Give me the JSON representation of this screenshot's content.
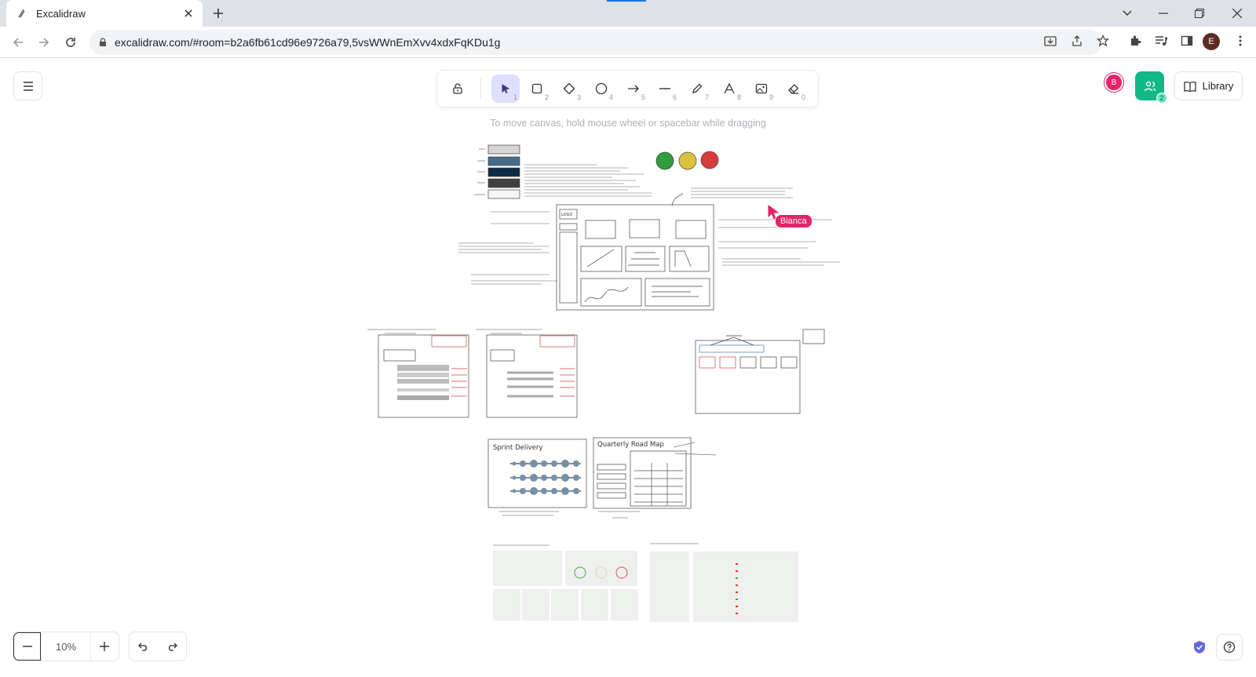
{
  "browser": {
    "tab_title": "Excalidraw",
    "url": "excalidraw.com/#room=b2a6fb61cd96e9726a79,5vsWWnEmXvv4xdxFqKDu1g",
    "profile_initial": "E"
  },
  "app": {
    "hint": "To move canvas, hold mouse wheel or spacebar while dragging",
    "library_label": "Library",
    "zoom": "10%",
    "collaborator_avatar": "B",
    "collaborator_count": "2",
    "collaborator_name": "Bianca",
    "tools": [
      {
        "name": "lock-icon",
        "key": ""
      },
      {
        "name": "selection-icon",
        "key": "1"
      },
      {
        "name": "rectangle-icon",
        "key": "2"
      },
      {
        "name": "diamond-icon",
        "key": "3"
      },
      {
        "name": "ellipse-icon",
        "key": "4"
      },
      {
        "name": "arrow-icon",
        "key": "5"
      },
      {
        "name": "line-icon",
        "key": "6"
      },
      {
        "name": "pencil-icon",
        "key": "7"
      },
      {
        "name": "text-icon",
        "key": "8"
      },
      {
        "name": "image-icon",
        "key": "9"
      },
      {
        "name": "eraser-icon",
        "key": "0"
      }
    ]
  },
  "canvas_text": {
    "sprint_title": "Sprint Delivery",
    "roadmap_title": "Quarterly Road Map",
    "logo_label": "LOGO"
  },
  "colors": {
    "accent": "#6965db",
    "share": "#0fb884",
    "collaborator": "#e4246a"
  }
}
